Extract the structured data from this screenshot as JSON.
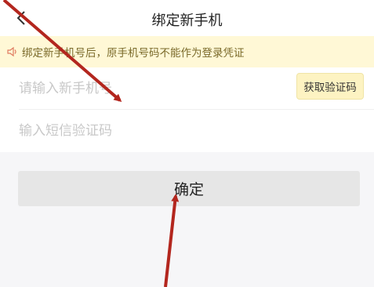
{
  "header": {
    "title": "绑定新手机",
    "back_icon": "chevron-left-icon"
  },
  "notice": {
    "icon": "speaker-icon",
    "text": "绑定新手机号后，原手机号码不能作为登录凭证",
    "background": "#fff8d6"
  },
  "form": {
    "phone_placeholder": "请输入新手机号",
    "get_code_label": "获取验证码",
    "sms_placeholder": "输入短信验证码"
  },
  "confirm_label": "确定",
  "annotation_color": "#b3261e"
}
